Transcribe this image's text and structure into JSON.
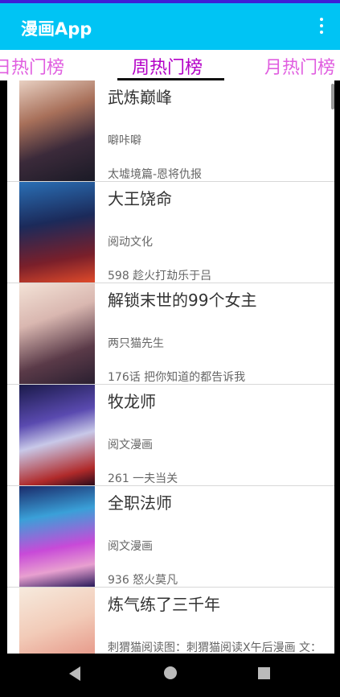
{
  "app_bar": {
    "title": "漫画App",
    "menu_icon": "more-vert-icon"
  },
  "tabs": [
    {
      "label": "日热门榜"
    },
    {
      "label": "周热门榜",
      "selected": true
    },
    {
      "label": "月热门榜"
    }
  ],
  "comics": [
    {
      "title": "武炼巅峰",
      "author": "噼咔噼",
      "chapter": "太墟境篇-恩将仇报"
    },
    {
      "title": "大王饶命",
      "author": "阅动文化",
      "chapter": "598 趁火打劫乐于吕"
    },
    {
      "title": "解锁末世的99个女主",
      "author": "两只猫先生",
      "chapter": "176话 把你知道的都告诉我"
    },
    {
      "title": "牧龙师",
      "author": "阅文漫画",
      "chapter": "261 一夫当关"
    },
    {
      "title": "全职法师",
      "author": "阅文漫画",
      "chapter": "936 怒火莫凡"
    },
    {
      "title": "炼气练了三千年",
      "author": "刺猬猫阅读图：刺猬猫阅读X午后漫画 文：",
      "chapter": ""
    }
  ],
  "nav": {
    "back_icon": "back-triangle-icon",
    "home_icon": "home-circle-icon",
    "recents_icon": "recents-square-icon"
  }
}
